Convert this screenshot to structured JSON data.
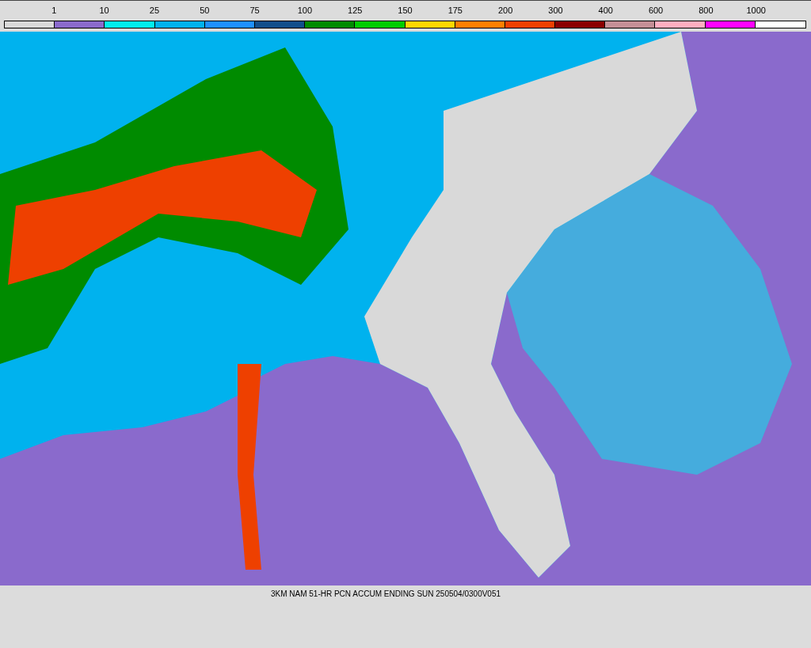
{
  "legend": {
    "swatches": [
      {
        "label": "1",
        "color": "#d9d9d9"
      },
      {
        "label": "10",
        "color": "#8a6acc"
      },
      {
        "label": "25",
        "color": "#00eeee"
      },
      {
        "label": "50",
        "color": "#00b2ee"
      },
      {
        "label": "75",
        "color": "#1e90ff"
      },
      {
        "label": "100",
        "color": "#104e8b"
      },
      {
        "label": "125",
        "color": "#008b00"
      },
      {
        "label": "150",
        "color": "#00cd00"
      },
      {
        "label": "175",
        "color": "#ffd700"
      },
      {
        "label": "200",
        "color": "#ff7f00"
      },
      {
        "label": "300",
        "color": "#ee4000"
      },
      {
        "label": "400",
        "color": "#8b0000"
      },
      {
        "label": "600",
        "color": "#c48f96"
      },
      {
        "label": "800",
        "color": "#ffaec0"
      },
      {
        "label": "1000",
        "color": "#ff00ff"
      },
      {
        "color": "#ffffff"
      }
    ]
  },
  "caption": "3KM NAM 51-HR PCN ACCUM ENDING SUN 250504/0300V051"
}
